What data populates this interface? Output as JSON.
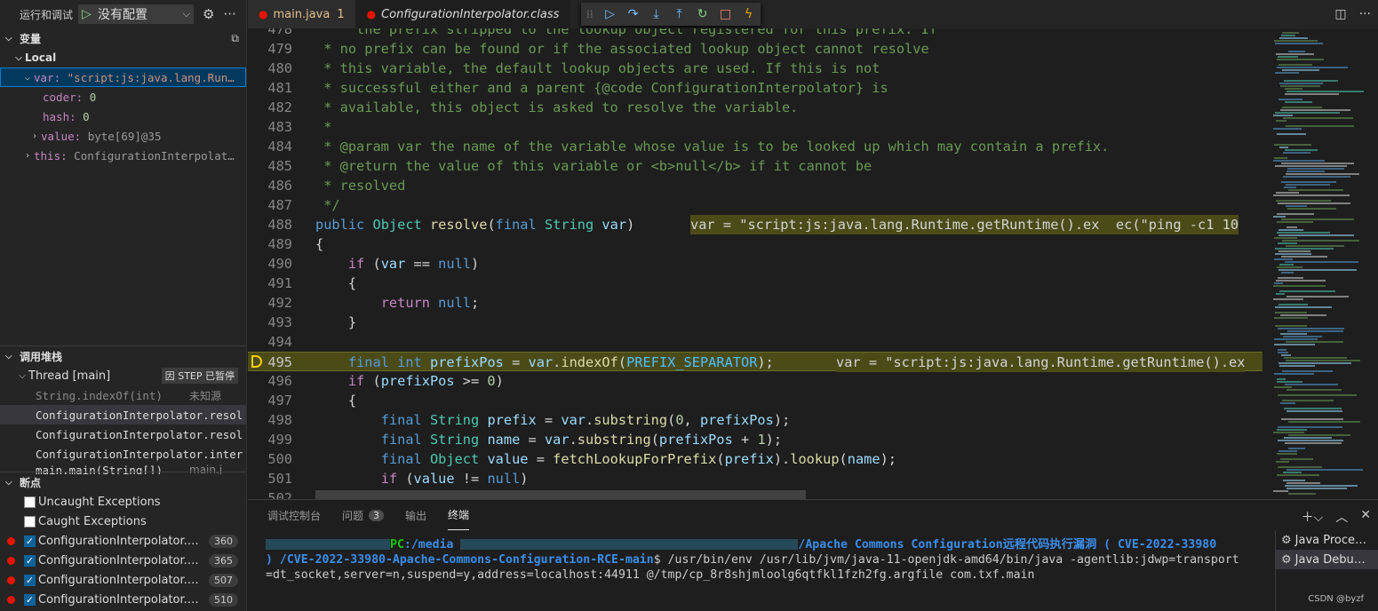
{
  "run_bar": {
    "title": "运行和调试",
    "config": "没有配置"
  },
  "variables": {
    "header": "变量",
    "scope": "Local",
    "items": [
      {
        "name": "var:",
        "value": "\"script:js:java.lang.Run…"
      },
      {
        "name": "coder:",
        "value": "0"
      },
      {
        "name": "hash:",
        "value": "0"
      },
      {
        "name": "value:",
        "value": "byte[69]@35"
      },
      {
        "name": "this:",
        "value": "ConfigurationInterpolat…"
      }
    ]
  },
  "callstack": {
    "header": "调用堆栈",
    "thread": "Thread [main]",
    "paused_badge": "因 STEP 已暂停",
    "frames": [
      {
        "text": "String.indexOf(int)",
        "source": "未知源"
      },
      {
        "text": "ConfigurationInterpolator.resol",
        "source": ""
      },
      {
        "text": "ConfigurationInterpolator.resol",
        "source": ""
      },
      {
        "text": "ConfigurationInterpolator.inter",
        "source": ""
      },
      {
        "text": "main.main(String[])",
        "source": "main.j"
      }
    ]
  },
  "breakpoints": {
    "header": "断点",
    "items": [
      {
        "label": "Uncaught Exceptions",
        "checked": false,
        "count": ""
      },
      {
        "label": "Caught Exceptions",
        "checked": false,
        "count": ""
      },
      {
        "label": "ConfigurationInterpolator.cl…",
        "checked": true,
        "count": "360"
      },
      {
        "label": "ConfigurationInterpolator.cl…",
        "checked": true,
        "count": "365"
      },
      {
        "label": "ConfigurationInterpolator.cl…",
        "checked": true,
        "count": "507"
      },
      {
        "label": "ConfigurationInterpolator.cl…",
        "checked": true,
        "count": "510"
      }
    ]
  },
  "tabs": [
    {
      "label": "main.java",
      "count": "1"
    },
    {
      "label": "ConfigurationInterpolator.class"
    }
  ],
  "editor": {
    "inline_var_488": "var = \"script:js:java.lang.Runtime.getRuntime().ex  ec(\"ping -c1 10",
    "inline_var_495": "var = \"script:js:java.lang.Runtime.getRuntime().ex",
    "lines": [
      {
        "n": "478",
        "text": "     the prefix stripped to the lookup object registered for this prefix. If"
      },
      {
        "n": "479",
        "text": " * no prefix can be found or if the associated lookup object cannot resolve"
      },
      {
        "n": "480",
        "text": " * this variable, the default lookup objects are used. If this is not"
      },
      {
        "n": "481",
        "text": " * successful either and a parent {@code ConfigurationInterpolator} is"
      },
      {
        "n": "482",
        "text": " * available, this object is asked to resolve the variable."
      },
      {
        "n": "483",
        "text": " *"
      },
      {
        "n": "484",
        "text": " * @param var the name of the variable whose value is to be looked up which may contain a prefix."
      },
      {
        "n": "485",
        "text": " * @return the value of this variable or <b>null</b> if it cannot be"
      },
      {
        "n": "486",
        "text": " * resolved"
      },
      {
        "n": "487",
        "text": " */"
      },
      {
        "n": "488",
        "text": "public Object resolve(final String var)"
      },
      {
        "n": "489",
        "text": "{"
      },
      {
        "n": "490",
        "text": "    if (var == null)"
      },
      {
        "n": "491",
        "text": "    {"
      },
      {
        "n": "492",
        "text": "        return null;"
      },
      {
        "n": "493",
        "text": "    }"
      },
      {
        "n": "494",
        "text": ""
      },
      {
        "n": "495",
        "text": "    final int prefixPos = var.indexOf(PREFIX_SEPARATOR);"
      },
      {
        "n": "496",
        "text": "    if (prefixPos >= 0)"
      },
      {
        "n": "497",
        "text": "    {"
      },
      {
        "n": "498",
        "text": "        final String prefix = var.substring(0, prefixPos);"
      },
      {
        "n": "499",
        "text": "        final String name = var.substring(prefixPos + 1);"
      },
      {
        "n": "500",
        "text": "        final Object value = fetchLookupForPrefix(prefix).lookup(name);"
      },
      {
        "n": "501",
        "text": "        if (value != null)"
      },
      {
        "n": "502",
        "text": "        {"
      }
    ]
  },
  "panel": {
    "tabs": [
      {
        "label": "调试控制台"
      },
      {
        "label": "问题",
        "badge": "3"
      },
      {
        "label": "输出"
      },
      {
        "label": "终端"
      }
    ],
    "terminal": {
      "prompt_host": "PC",
      "path_start": ":/media",
      "path_end": "/Apache Commons Configuration远程代码执行漏洞 ( CVE-2022-33980",
      "path_line2": ") /CVE-2022-33980-Apache-Commons-Configuration-RCE-main",
      "command": "$  /usr/bin/env /usr/lib/jvm/java-11-openjdk-amd64/bin/java -agentlib:jdwp=transport",
      "command_line2": "=dt_socket,server=n,suspend=y,address=localhost:44911 @/tmp/cp_8r8shjmloolg6qtfkl1fzh2fg.argfile com.txf.main"
    },
    "terminals": [
      "Java Proce…",
      "Java Debu…"
    ],
    "watermark": "CSDN @byzf"
  },
  "colors": {
    "accent": "#007fd4",
    "breakpoint": "#e51400",
    "current_line": "#4b4b18"
  }
}
